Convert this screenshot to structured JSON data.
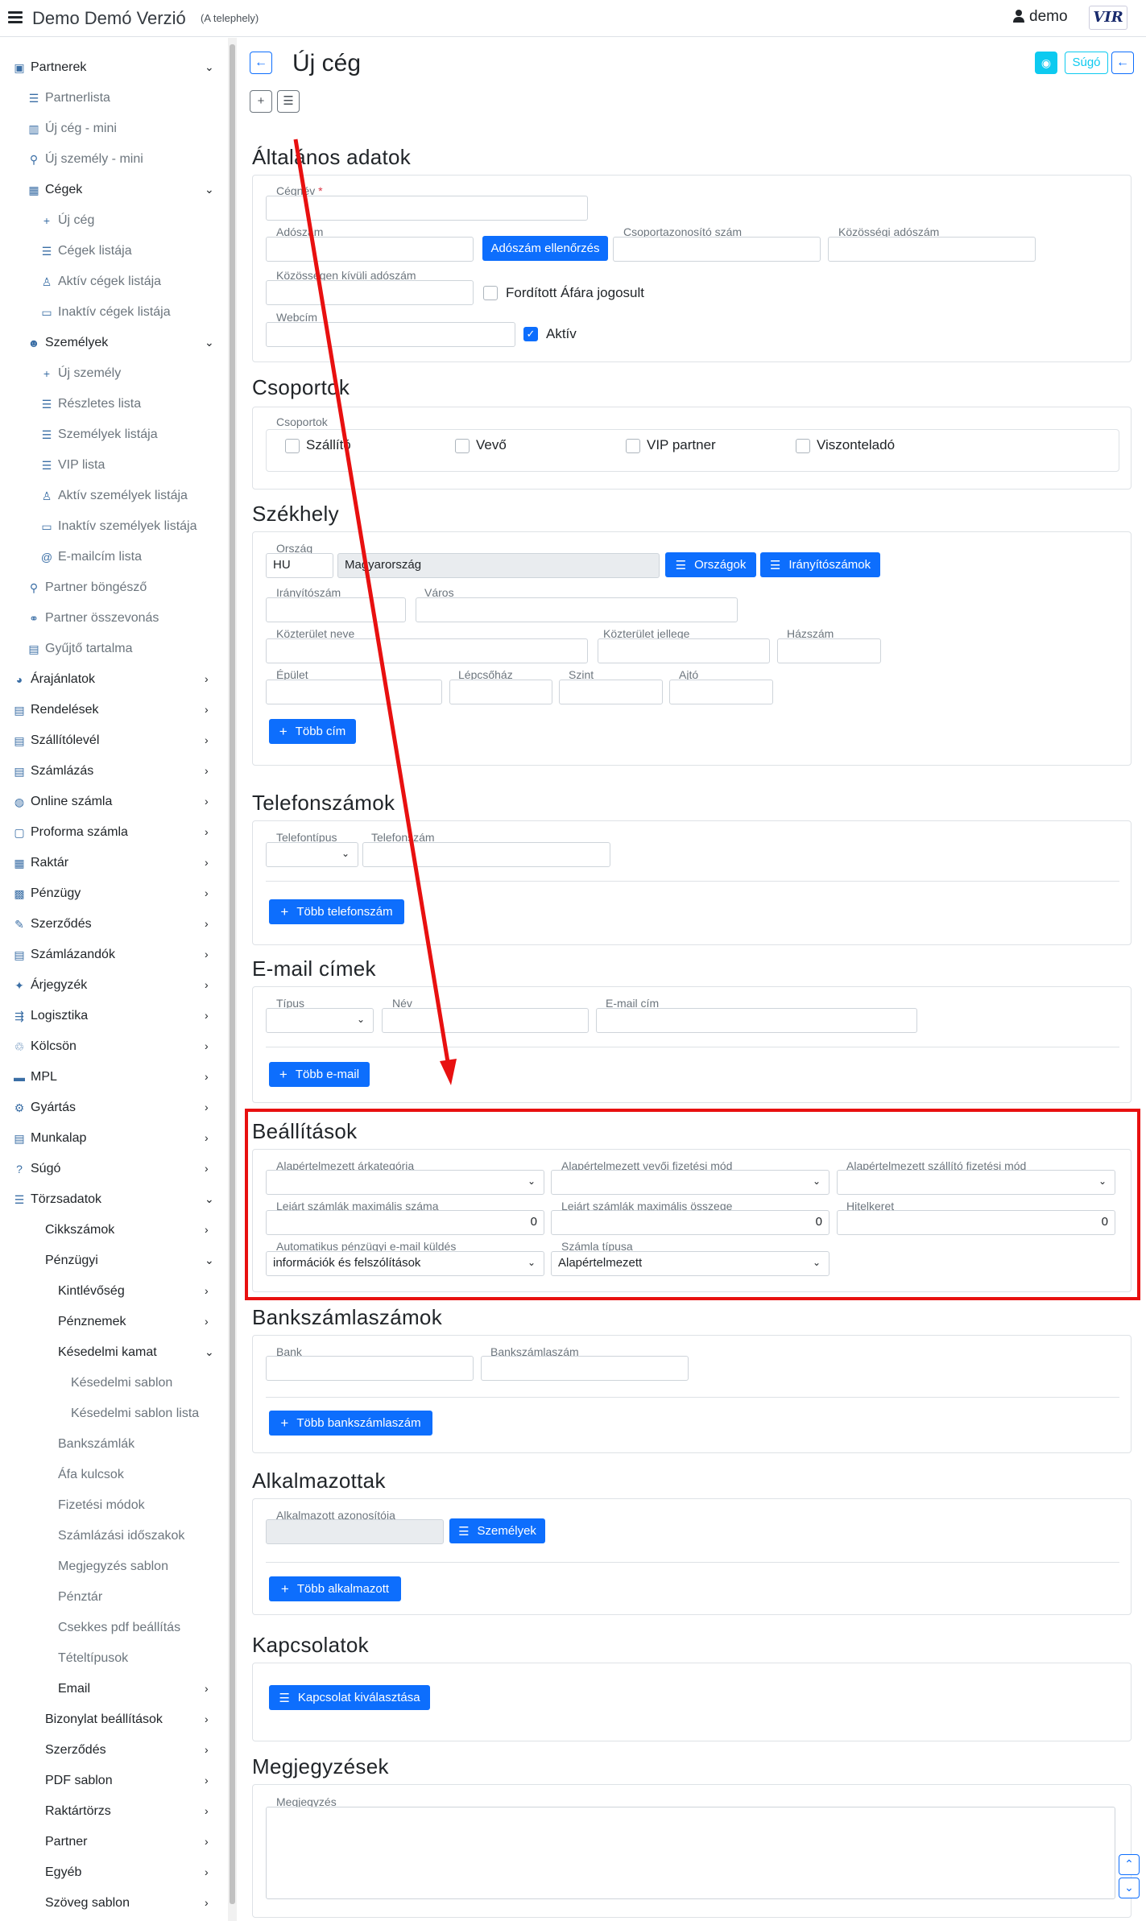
{
  "app": {
    "title": "Demo Demó Verzió",
    "subtitle": "(A telephely)",
    "user": "demo",
    "logo_text": "VIR"
  },
  "sidebar": {
    "items": [
      "Partnerek",
      "Partnerlista",
      "Új cég - mini",
      "Új személy - mini",
      "Cégek",
      "Új cég",
      "Cégek listája",
      "Aktív cégek listája",
      "Inaktív cégek listája",
      "Személyek",
      "Új személy",
      "Részletes lista",
      "Személyek listája",
      "VIP lista",
      "Aktív személyek listája",
      "Inaktív személyek listája",
      "E-mailcím lista",
      "Partner böngésző",
      "Partner összevonás",
      "Gyűjtő tartalma",
      "Árajánlatok",
      "Rendelések",
      "Szállítólevél",
      "Számlázás",
      "Online számla",
      "Proforma számla",
      "Raktár",
      "Pénzügy",
      "Szerződés",
      "Számlázandók",
      "Árjegyzék",
      "Logisztika",
      "Kölcsön",
      "MPL",
      "Gyártás",
      "Munkalap",
      "Súgó",
      "Törzsadatok",
      "Cikkszámok",
      "Pénzügyi",
      "Kintlévőség",
      "Pénznemek",
      "Késedelmi kamat",
      "Késedelmi sablon",
      "Késedelmi sablon lista",
      "Bankszámlák",
      "Áfa kulcsok",
      "Fizetési módok",
      "Számlázási időszakok",
      "Megjegyzés sablon",
      "Pénztár",
      "Csekkes pdf beállítás",
      "Tételtípusok",
      "Email",
      "Bizonylat beállítások",
      "Szerződés",
      "PDF sablon",
      "Raktártörzs",
      "Partner",
      "Egyéb",
      "Szöveg sablon"
    ]
  },
  "page": {
    "title": "Új cég",
    "help_label": "Súgó"
  },
  "sections": {
    "general": "Általános adatok",
    "groups": "Csoportok",
    "seat": "Székhely",
    "phones": "Telefonszámok",
    "emails": "E-mail címek",
    "settings": "Beállítások",
    "bank": "Bankszámlaszámok",
    "employees": "Alkalmazottak",
    "contacts": "Kapcsolatok",
    "notes": "Megjegyzések"
  },
  "general": {
    "company_name": "Cégnév",
    "req": "*",
    "tax_number": "Adószám",
    "tax_check_btn": "Adószám ellenőrzés",
    "group_id": "Csoportazonosító szám",
    "community_tax": "Közösségi adószám",
    "foreign_tax": "Közösségen kívüli adószám",
    "reverse_vat": "Fordított Áfára jogosult",
    "website": "Webcím",
    "active": "Aktív"
  },
  "groups": {
    "label": "Csoportok",
    "options": [
      "Szállító",
      "Vevő",
      "VIP partner",
      "Viszonteladó"
    ]
  },
  "seat": {
    "country_label": "Ország",
    "country_code": "HU",
    "country_name": "Magyarország",
    "countries_btn": "Országok",
    "zips_btn": "Irányítószámok",
    "zip": "Irányítószám",
    "city": "Város",
    "street_name": "Közterület neve",
    "street_type": "Közterület jellege",
    "house_no": "Házszám",
    "building": "Épület",
    "stairway": "Lépcsőház",
    "floor": "Szint",
    "door": "Ajtó",
    "more_btn": "Több cím"
  },
  "phones": {
    "type": "Telefontípus",
    "number": "Telefonszám",
    "more_btn": "Több telefonszám"
  },
  "emails": {
    "type": "Típus",
    "name": "Név",
    "address": "E-mail cím",
    "more_btn": "Több e-mail"
  },
  "settings": {
    "price_cat": "Alapértelmezett árkategória",
    "buyer_pay": "Alapértelmezett vevői fizetési mód",
    "supplier_pay": "Alapértelmezett szállító fizetési mód",
    "max_overdue_count": "Lejárt számlák maximális száma",
    "max_overdue_count_val": "0",
    "max_overdue_sum": "Lejárt számlák maximális összege",
    "max_overdue_sum_val": "0",
    "credit": "Hitelkeret",
    "credit_val": "0",
    "auto_email": "Automatikus pénzügyi e-mail küldés",
    "auto_email_val": "információk és felszólítások",
    "invoice_type": "Számla típusa",
    "invoice_type_val": "Alapértelmezett"
  },
  "bank": {
    "bank": "Bank",
    "account": "Bankszámlaszám",
    "more_btn": "Több bankszámlaszám"
  },
  "employees": {
    "id": "Alkalmazott azonosítója",
    "persons_btn": "Személyek",
    "more_btn": "Több alkalmazott"
  },
  "contacts": {
    "select_btn": "Kapcsolat kiválasztása"
  },
  "notes": {
    "label": "Megjegyzés"
  },
  "colors": {
    "primary": "#0d6efd",
    "annotation": "#e81010"
  }
}
